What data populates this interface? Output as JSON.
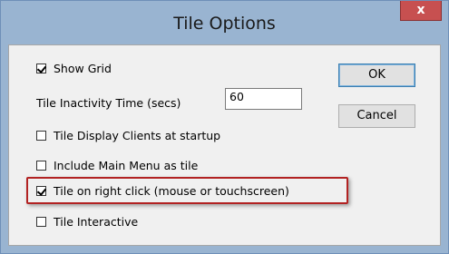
{
  "window": {
    "title": "Tile Options",
    "close_label": "x"
  },
  "options": {
    "show_grid": {
      "label": "Show Grid",
      "checked": true
    },
    "inactivity": {
      "label": "Tile Inactivity Time (secs)",
      "value": "60"
    },
    "display_clients": {
      "label": "Tile Display Clients at startup",
      "checked": false
    },
    "include_main_menu": {
      "label": "Include Main Menu as tile",
      "checked": false
    },
    "right_click": {
      "label": "Tile on right click (mouse or touchscreen)",
      "checked": true,
      "highlighted": true
    },
    "interactive": {
      "label": "Tile Interactive",
      "checked": false
    }
  },
  "buttons": {
    "ok": "OK",
    "cancel": "Cancel"
  },
  "colors": {
    "title_bar": "#99b4d1",
    "close_button": "#c75050",
    "dialog_bg": "#f0f0f0",
    "highlight": "#b22222"
  }
}
